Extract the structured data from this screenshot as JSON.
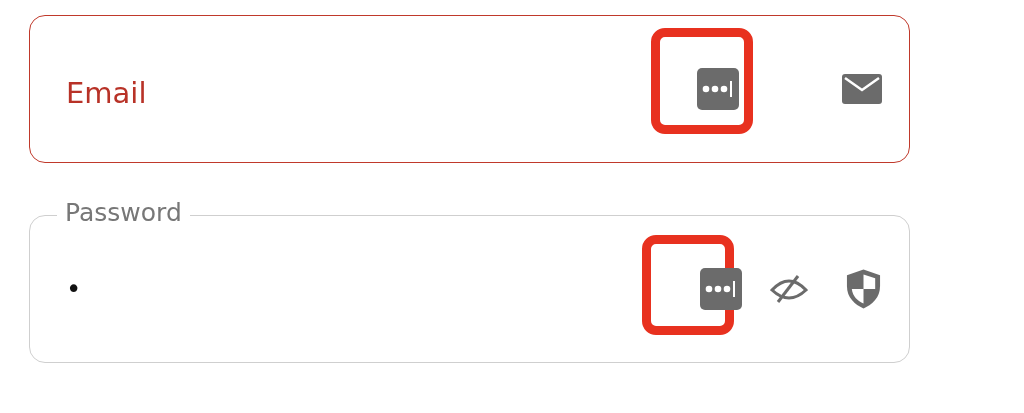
{
  "fields": [
    {
      "kind": "email",
      "label": "Email",
      "error": true,
      "key_highlighted": true
    },
    {
      "kind": "password",
      "label": "Password",
      "value": "•",
      "error": false,
      "key_highlighted": true
    }
  ]
}
